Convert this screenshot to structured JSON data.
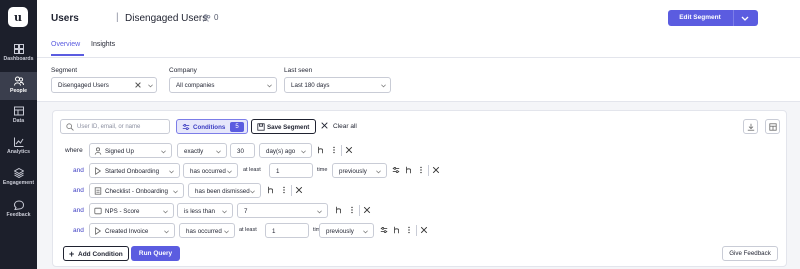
{
  "sidebar": {
    "items": [
      {
        "label": "Dashboards",
        "icon": "dashboard-icon"
      },
      {
        "label": "People",
        "icon": "people-icon",
        "active": true
      },
      {
        "label": "Data",
        "icon": "data-icon"
      },
      {
        "label": "Analytics",
        "icon": "analytics-icon"
      },
      {
        "label": "Engagement",
        "icon": "engagement-icon"
      },
      {
        "label": "Feedback",
        "icon": "feedback-icon"
      }
    ]
  },
  "header": {
    "title": "Users",
    "separator": "|",
    "segment_name": "Disengaged Users",
    "user_count": "0",
    "edit_button": "Edit Segment",
    "tabs": [
      {
        "label": "Overview",
        "active": true
      },
      {
        "label": "Insights"
      }
    ]
  },
  "filters": {
    "segment_label": "Segment",
    "segment_value": "Disengaged Users",
    "company_label": "Company",
    "company_value": "All companies",
    "last_seen_label": "Last seen",
    "last_seen_value": "Last 180 days"
  },
  "query": {
    "search_placeholder": "User ID, email, or name",
    "conditions_label": "Conditions",
    "conditions_count": "5",
    "save_label": "Save Segment",
    "clear_label": "Clear all",
    "rows": [
      {
        "conj": "where",
        "field": "Signed Up",
        "op": "exactly",
        "value": "30",
        "unit": "day(s) ago"
      },
      {
        "conj": "and",
        "field": "Started Onboarding",
        "op": "has occurred",
        "qual": "at least",
        "value": "1",
        "unit_label": "time",
        "period": "previously"
      },
      {
        "conj": "and",
        "field": "Checklist - Onboarding",
        "op": "has been dismissed"
      },
      {
        "conj": "and",
        "field": "NPS - Score",
        "op": "is less than",
        "value": "7"
      },
      {
        "conj": "and",
        "field": "Created Invoice",
        "op": "has occurred",
        "qual": "at least",
        "value": "1",
        "unit_label": "time",
        "period": "previously"
      }
    ],
    "add_condition": "Add Condition",
    "run_query": "Run Query",
    "give_feedback": "Give Feedback"
  },
  "colors": {
    "accent": "#5b5ce0",
    "sidebar_bg": "#1c1f2b"
  }
}
